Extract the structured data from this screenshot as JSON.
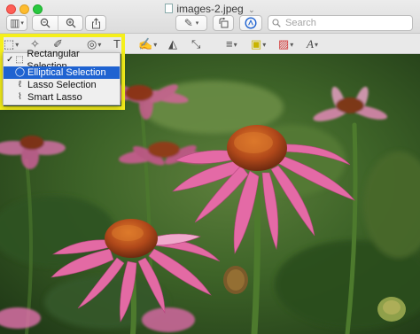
{
  "window": {
    "title": "images-2.jpeg",
    "title_caret": "⌄"
  },
  "toolbar": {
    "sidebar_icon": "▥",
    "sidebar_caret": "▾",
    "zoom_out_icon": "−",
    "zoom_in_icon": "+",
    "share_icon": "⇧",
    "pen_icon": "✎",
    "pen_caret": "▾",
    "rotate_icon": "↺",
    "markup_icon": "Ⓐ",
    "search_placeholder": "Search"
  },
  "markup": {
    "selection_icon": "⬚",
    "instant_alpha_icon": "✧",
    "sketch_icon": "✐",
    "shapes_icon": "◎",
    "text_icon": "T",
    "sign_icon": "✍",
    "adjust_color_icon": "◭",
    "adjust_size_icon": "⤡",
    "line_style_icon": "≡",
    "border_color_icon": "▣",
    "fill_color_icon": "▨",
    "text_style_icon": "A",
    "caret": "▾"
  },
  "selection_menu": {
    "items": [
      {
        "label": "Rectangular Selection",
        "icon": "⬚",
        "checked": true,
        "selected": false
      },
      {
        "label": "Elliptical Selection",
        "icon": "◯",
        "checked": false,
        "selected": true
      },
      {
        "label": "Lasso Selection",
        "icon": "ℓ",
        "checked": false,
        "selected": false
      },
      {
        "label": "Smart Lasso",
        "icon": "⌇",
        "checked": false,
        "selected": false
      }
    ],
    "check_mark": "✓"
  },
  "colors": {
    "highlight_border": "#f5ef1b",
    "menu_selected": "#1f63d1",
    "petal": "#e46aa6",
    "cone": "#c8501c",
    "foliage": "#3f6a30"
  }
}
